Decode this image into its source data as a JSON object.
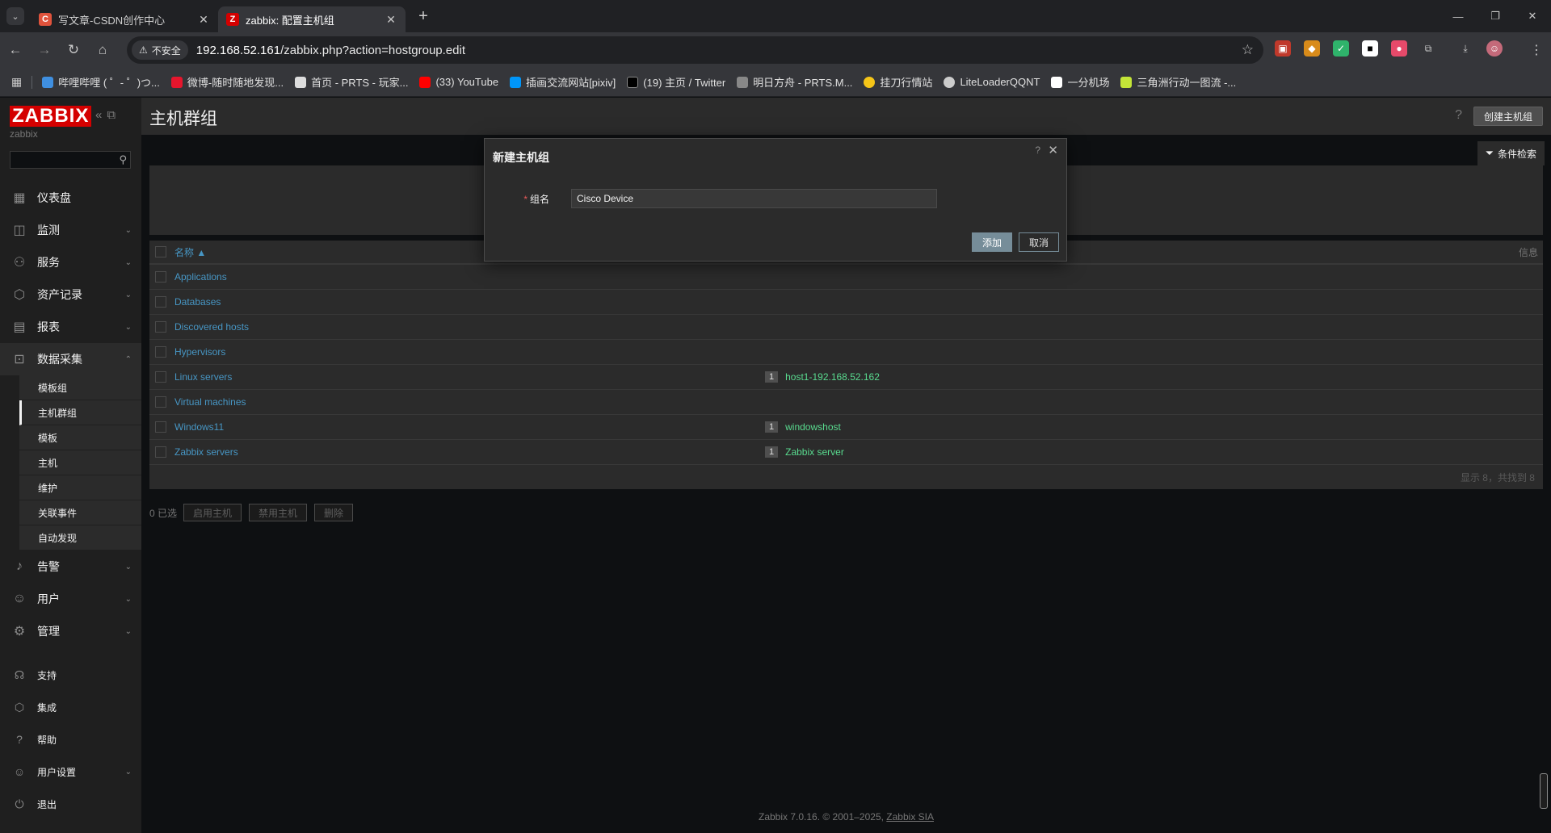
{
  "browser": {
    "tabs": [
      {
        "title": "写文章-CSDN创作中心",
        "favicon_color": "#e0533c",
        "favicon_letter": "C"
      },
      {
        "title": "zabbix: 配置主机组",
        "favicon_color": "#d40000",
        "favicon_letter": "Z"
      }
    ],
    "secure_label": "不安全",
    "url_host": "192.168.52.161",
    "url_path": "/zabbix.php?action=hostgroup.edit",
    "bookmarks": [
      {
        "label": "哔哩哔哩 ( ゜- ゜)つ...",
        "color": "#3f8fe0"
      },
      {
        "label": "微博-随时随地发现...",
        "color": "#e6162d"
      },
      {
        "label": "首页 - PRTS - 玩家...",
        "color": "#dddddd"
      },
      {
        "label": "(33) YouTube",
        "color": "#ff0000"
      },
      {
        "label": "插画交流网站[pixiv]",
        "color": "#0096fa"
      },
      {
        "label": "(19) 主页 / Twitter",
        "color": "#000000"
      },
      {
        "label": "明日方舟 - PRTS.M...",
        "color": "#888888"
      },
      {
        "label": "挂刀行情站",
        "color": "#f5c518"
      },
      {
        "label": "LiteLoaderQQNT",
        "color": "#cccccc"
      },
      {
        "label": "一分机场",
        "color": "#ffffff"
      },
      {
        "label": "三角洲行动一图流 -...",
        "color": "#c4e538"
      }
    ]
  },
  "sidebar": {
    "logo": "ZABBIX",
    "server_name": "zabbix",
    "menu": [
      {
        "label": "仪表盘",
        "icon": "dashboard-icon"
      },
      {
        "label": "监测",
        "icon": "monitoring-icon"
      },
      {
        "label": "服务",
        "icon": "services-icon"
      },
      {
        "label": "资产记录",
        "icon": "inventory-icon"
      },
      {
        "label": "报表",
        "icon": "reports-icon"
      },
      {
        "label": "数据采集",
        "icon": "data-collection-icon"
      }
    ],
    "submenu": [
      "模板组",
      "主机群组",
      "模板",
      "主机",
      "维护",
      "关联事件",
      "自动发现"
    ],
    "menu2": [
      {
        "label": "告警",
        "icon": "alerts-icon"
      },
      {
        "label": "用户",
        "icon": "users-icon"
      },
      {
        "label": "管理",
        "icon": "administration-icon"
      }
    ],
    "bottom": [
      {
        "label": "支持",
        "icon": "support-icon"
      },
      {
        "label": "集成",
        "icon": "integrations-icon"
      },
      {
        "label": "帮助",
        "icon": "help-icon"
      },
      {
        "label": "用户设置",
        "icon": "user-settings-icon"
      },
      {
        "label": "退出",
        "icon": "signout-icon"
      }
    ]
  },
  "main": {
    "page_title": "主机群组",
    "create_button": "创建主机组",
    "filter_label": "条件检索",
    "table": {
      "col_name": "名称 ▲",
      "col_info": "信息",
      "rows": [
        {
          "name": "Applications",
          "count": "",
          "host": ""
        },
        {
          "name": "Databases",
          "count": "",
          "host": ""
        },
        {
          "name": "Discovered hosts",
          "count": "",
          "host": ""
        },
        {
          "name": "Hypervisors",
          "count": "",
          "host": ""
        },
        {
          "name": "Linux servers",
          "count": "1",
          "host": "host1-192.168.52.162"
        },
        {
          "name": "Virtual machines",
          "count": "",
          "host": ""
        },
        {
          "name": "Windows11",
          "count": "1",
          "host": "windowshost"
        },
        {
          "name": "Zabbix servers",
          "count": "1",
          "host": "Zabbix server"
        }
      ],
      "footer": "显示 8，共找到 8"
    },
    "selected": "0 已选",
    "actions": [
      "启用主机",
      "禁用主机",
      "删除"
    ],
    "footer_text": "Zabbix 7.0.16. © 2001–2025, ",
    "footer_link": "Zabbix SIA"
  },
  "modal": {
    "title": "新建主机组",
    "field_label": "组名",
    "field_value": "Cisco Device",
    "add_label": "添加",
    "cancel_label": "取消"
  }
}
